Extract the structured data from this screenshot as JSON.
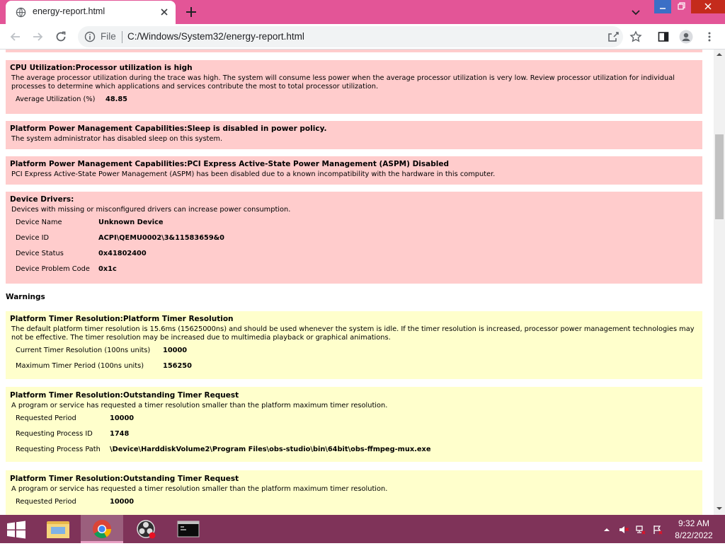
{
  "browser": {
    "tab_title": "energy-report.html",
    "omnibox_scheme_label": "File",
    "url": "C:/Windows/System32/energy-report.html"
  },
  "report": {
    "errors": [
      {
        "title": "CPU Utilization:Processor utilization is high",
        "description": "The average processor utilization during the trace was high. The system will consume less power when the average processor utilization is very low. Review processor utilization for individual processes to determine which applications and services contribute the most to total processor utilization.",
        "fields": [
          {
            "label": "Average Utilization (%)",
            "value": "48.85"
          }
        ]
      },
      {
        "title": "Platform Power Management Capabilities:Sleep is disabled in power policy.",
        "description": "The system administrator has disabled sleep on this system.",
        "fields": []
      },
      {
        "title": "Platform Power Management Capabilities:PCI Express Active-State Power Management (ASPM) Disabled",
        "description": "PCI Express Active-State Power Management (ASPM) has been disabled due to a known incompatibility with the hardware in this computer.",
        "fields": []
      },
      {
        "title": "Device Drivers:",
        "description": "Devices with missing or misconfigured drivers can increase power consumption.",
        "fields": [
          {
            "label": "Device Name",
            "value": "Unknown Device"
          },
          {
            "label": "Device ID",
            "value": "ACPI\\QEMU0002\\3&11583659&0"
          },
          {
            "label": "Device Status",
            "value": "0x41802400"
          },
          {
            "label": "Device Problem Code",
            "value": "0x1c"
          }
        ]
      }
    ],
    "warnings_heading": "Warnings",
    "warnings": [
      {
        "title": "Platform Timer Resolution:Platform Timer Resolution",
        "description": "The default platform timer resolution is 15.6ms (15625000ns) and should be used whenever the system is idle. If the timer resolution is increased, processor power management technologies may not be effective. The timer resolution may be increased due to multimedia playback or graphical animations.",
        "fields": [
          {
            "label": "Current Timer Resolution (100ns units)",
            "value": "10000"
          },
          {
            "label": "Maximum Timer Period (100ns units)",
            "value": "156250"
          }
        ]
      },
      {
        "title": "Platform Timer Resolution:Outstanding Timer Request",
        "description": "A program or service has requested a timer resolution smaller than the platform maximum timer resolution.",
        "fields": [
          {
            "label": "Requested Period",
            "value": "10000"
          },
          {
            "label": "Requesting Process ID",
            "value": "1748"
          },
          {
            "label": "Requesting Process Path",
            "value": "\\Device\\HarddiskVolume2\\Program Files\\obs-studio\\bin\\64bit\\obs-ffmpeg-mux.exe"
          }
        ]
      },
      {
        "title": "Platform Timer Resolution:Outstanding Timer Request",
        "description": "A program or service has requested a timer resolution smaller than the platform maximum timer resolution.",
        "fields": [
          {
            "label": "Requested Period",
            "value": "10000"
          }
        ]
      }
    ]
  },
  "taskbar": {
    "time": "9:32 AM",
    "date": "8/22/2022",
    "apps": [
      "file-explorer",
      "chrome",
      "obs-studio",
      "command-prompt"
    ]
  },
  "colors": {
    "titlebar": "#e35597",
    "error_box": "#ffcccc",
    "warning_box": "#ffffcc",
    "taskbar": "#7f3359"
  }
}
